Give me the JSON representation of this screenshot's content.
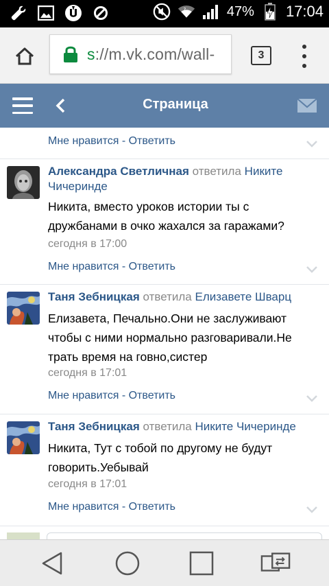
{
  "status_bar": {
    "battery_percent": "47%",
    "time": "17:04",
    "icons_left": [
      "wrench-icon",
      "image-icon",
      "torrent-icon",
      "blocked-icon"
    ],
    "icons_right": [
      "mute-icon",
      "wifi-icon",
      "signal-icon",
      "battery-charging-icon"
    ]
  },
  "browser": {
    "url_scheme": "s",
    "url_rest": "://m.vk.com/wall-",
    "tab_count": "3"
  },
  "header": {
    "title": "Страница"
  },
  "colors": {
    "header_bg": "#5e80a7",
    "link": "#2b5788",
    "secure": "#0c8a3e"
  },
  "top_actions": {
    "like": "Мне нравится",
    "separator": " - ",
    "reply": "Ответить"
  },
  "comments": [
    {
      "author": "Александра Светличная",
      "verb": "ответила",
      "target": "Никите Чичеринде",
      "text": "Никита, вместо уроков истории ты с дружбанами в очко жахался за гаражами?",
      "time": "сегодня в 17:00",
      "like": "Мне нравится",
      "separator": " - ",
      "reply": "Ответить"
    },
    {
      "author": "Таня Зебницкая",
      "verb": "ответила",
      "target": "Елизавете Шварц",
      "text": "Елизавета, Печально.Они не заслуживают чтобы с ними нормально разговаривали.Не трать время на говно,систер",
      "time": "сегодня в 17:01",
      "like": "Мне нравится",
      "separator": " - ",
      "reply": "Ответить"
    },
    {
      "author": "Таня Зебницкая",
      "verb": "ответила",
      "target": "Никите Чичеринде",
      "text": "Никита, Тут с тобой по другому не будут говорить.Уебывай",
      "time": "сегодня в 17:01",
      "like": "Мне нравится",
      "separator": " - ",
      "reply": "Ответить"
    }
  ]
}
